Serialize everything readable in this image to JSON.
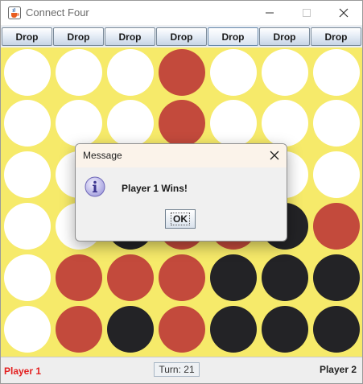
{
  "window": {
    "title": "Connect Four",
    "app_icon": "java-cup-icon",
    "controls": [
      "minimize-icon",
      "maximize-icon",
      "close-icon"
    ]
  },
  "drop_buttons": [
    "Drop",
    "Drop",
    "Drop",
    "Drop",
    "Drop",
    "Drop",
    "Drop"
  ],
  "board": {
    "rows": 6,
    "cols": 7,
    "cells": [
      [
        "empty",
        "empty",
        "empty",
        "red",
        "empty",
        "empty",
        "empty"
      ],
      [
        "empty",
        "empty",
        "empty",
        "red",
        "empty",
        "empty",
        "empty"
      ],
      [
        "empty",
        "empty",
        "empty",
        "red",
        "empty",
        "empty",
        "empty"
      ],
      [
        "empty",
        "empty",
        "black",
        "red",
        "red",
        "black",
        "red"
      ],
      [
        "empty",
        "red",
        "red",
        "red",
        "black",
        "black",
        "black"
      ],
      [
        "empty",
        "red",
        "black",
        "red",
        "black",
        "black",
        "black"
      ]
    ],
    "colors": {
      "board": "#f6ea6a",
      "empty": "#ffffff",
      "red": "#c34a3c",
      "black": "#232326"
    }
  },
  "status": {
    "player1": "Player 1",
    "player1_color": "#e32020",
    "turn": "Turn: 21",
    "player2": "Player 2"
  },
  "dialog": {
    "title": "Message",
    "icon": "info-icon",
    "message": "Player 1 Wins!",
    "ok_label": "OK"
  }
}
